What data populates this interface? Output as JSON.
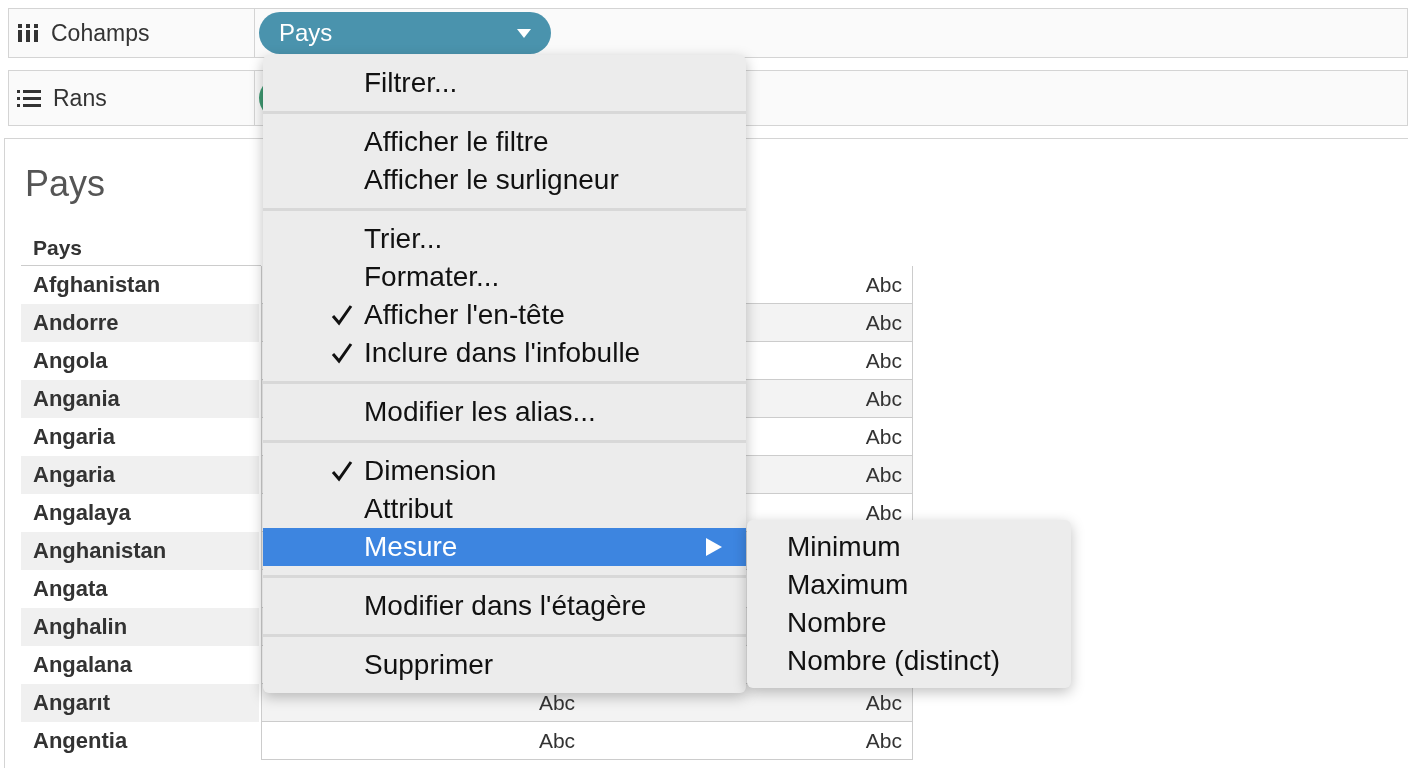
{
  "shelves": [
    {
      "kind": "columns",
      "label": "Cohamps",
      "pill": {
        "label": "Pays",
        "color": "#4a93ad"
      }
    },
    {
      "kind": "rows",
      "label": "Rans",
      "pill": {
        "color": "#3f9a72"
      }
    }
  ],
  "view": {
    "title": "Pays",
    "table": {
      "header": "Pays",
      "rows": [
        {
          "name": "Afghanistan",
          "column_2": "Abc"
        },
        {
          "name": "Andorre",
          "column_2": "Abc"
        },
        {
          "name": "Angola",
          "column_2": "Abc"
        },
        {
          "name": "Angania",
          "column_2": "Abc"
        },
        {
          "name": "Angaria",
          "column_2": "Abc"
        },
        {
          "name": "Angaria",
          "column_2": "Abc"
        },
        {
          "name": "Angalaya",
          "column_2": "Abc"
        },
        {
          "name": "Anghanistan"
        },
        {
          "name": "Angata"
        },
        {
          "name": "Anghalin"
        },
        {
          "name": "Angalana"
        },
        {
          "name": "Angarıt",
          "column_1": "Abc",
          "column_2": "Abc"
        },
        {
          "name": "Angentia",
          "column_1": "Abc",
          "column_2": "Abc"
        }
      ]
    }
  },
  "context_menu": {
    "sections": [
      {
        "items": [
          {
            "label": "Filtrer...",
            "checked": false,
            "selected": false
          }
        ]
      },
      {
        "items": [
          {
            "label": "Afficher le filtre",
            "checked": false,
            "selected": false
          },
          {
            "label": "Afficher le surligneur",
            "checked": false,
            "selected": false
          }
        ]
      },
      {
        "items": [
          {
            "label": "Trier...",
            "checked": false,
            "selected": false
          },
          {
            "label": "Formater...",
            "checked": false,
            "selected": false
          },
          {
            "label": "Afficher l'en-tête",
            "checked": true,
            "selected": false
          },
          {
            "label": "Inclure dans l'infobulle",
            "checked": true,
            "selected": false
          }
        ]
      },
      {
        "items": [
          {
            "label": "Modifier les alias...",
            "checked": false,
            "selected": false
          }
        ]
      },
      {
        "items": [
          {
            "label": "Dimension",
            "checked": true,
            "selected": false
          },
          {
            "label": "Attribut",
            "checked": false,
            "selected": false
          },
          {
            "label": "Mesure",
            "checked": false,
            "selected": true,
            "submenu": true
          }
        ]
      },
      {
        "items": [
          {
            "label": "Modifier dans l'étagère",
            "checked": false,
            "selected": false
          }
        ]
      },
      {
        "items": [
          {
            "label": "Supprimer",
            "checked": false,
            "selected": false
          }
        ]
      }
    ]
  },
  "submenu": {
    "items": [
      {
        "label": "Minimum"
      },
      {
        "label": "Maximum"
      },
      {
        "label": "Nombre"
      },
      {
        "label": "Nombre (distinct)"
      }
    ]
  }
}
